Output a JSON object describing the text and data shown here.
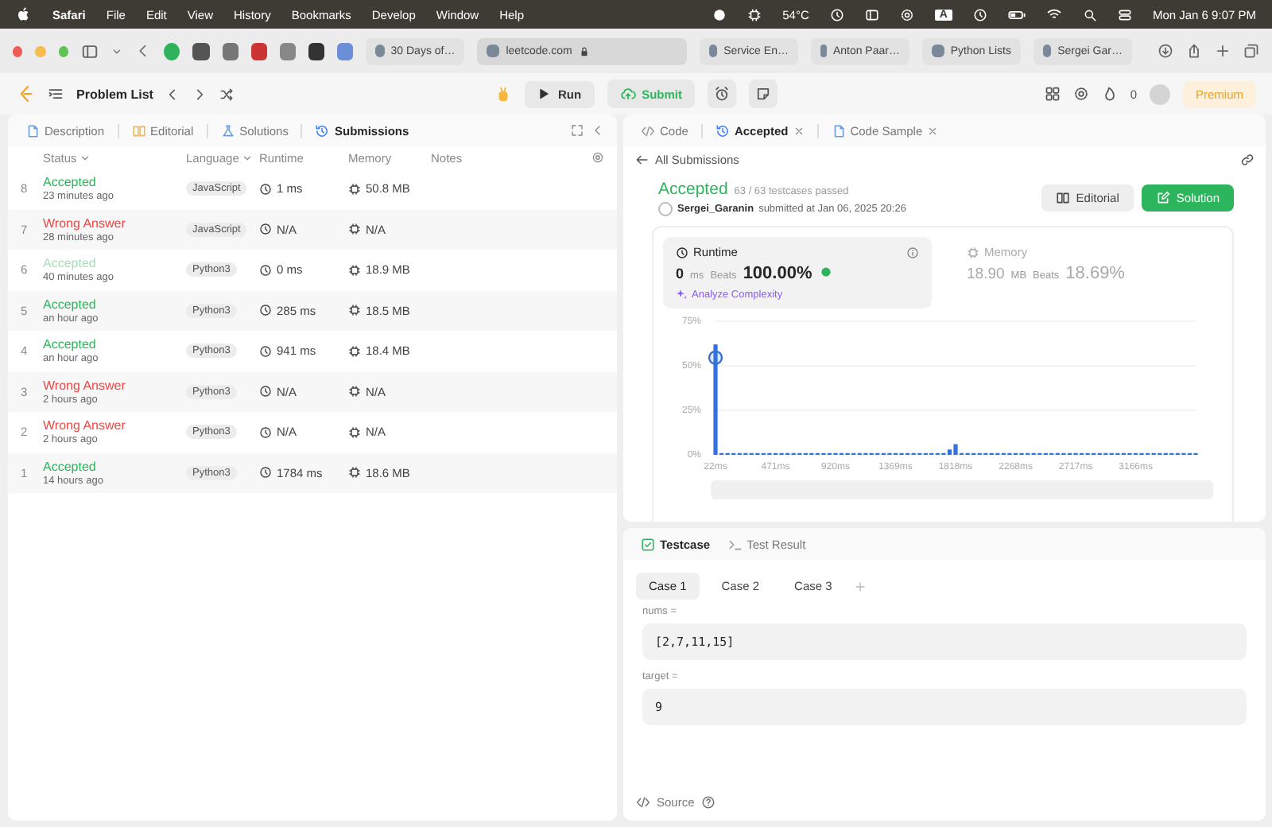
{
  "menu_bar": {
    "app": "Safari",
    "items": [
      "File",
      "Edit",
      "View",
      "History",
      "Bookmarks",
      "Develop",
      "Window",
      "Help"
    ],
    "temperature": "54°C",
    "input_source": "A",
    "clock": "Mon Jan 6  9:07 PM"
  },
  "browser": {
    "tabs": [
      {
        "label": "30 Days of…",
        "selected": false
      },
      {
        "label": "leetcode.com",
        "selected": true
      },
      {
        "label": "Service En…",
        "selected": false
      },
      {
        "label": "Anton Paar…",
        "selected": false
      },
      {
        "label": "Python Lists",
        "selected": false
      },
      {
        "label": "Sergei Gar…",
        "selected": false
      }
    ]
  },
  "nav": {
    "title": "Problem List",
    "run": "Run",
    "submit": "Submit",
    "streak": "0",
    "premium": "Premium"
  },
  "left_panel": {
    "tabs": [
      {
        "label": "Description",
        "selected": false
      },
      {
        "label": "Editorial",
        "selected": false
      },
      {
        "label": "Solutions",
        "selected": false
      },
      {
        "label": "Submissions",
        "selected": true
      }
    ],
    "columns": [
      "Status",
      "Language",
      "Runtime",
      "Memory",
      "Notes"
    ],
    "rows": [
      {
        "index": "8",
        "status": "Accepted",
        "kind": "accepted",
        "time": "23 minutes ago",
        "language": "JavaScript",
        "runtime": "1 ms",
        "memory": "50.8 MB",
        "selected": false
      },
      {
        "index": "7",
        "status": "Wrong Answer",
        "kind": "wrong",
        "time": "28 minutes ago",
        "language": "JavaScript",
        "runtime": "N/A",
        "memory": "N/A",
        "selected": false
      },
      {
        "index": "6",
        "status": "Accepted",
        "kind": "accepted",
        "time": "40 minutes ago",
        "language": "Python3",
        "runtime": "0 ms",
        "memory": "18.9 MB",
        "selected": true
      },
      {
        "index": "5",
        "status": "Accepted",
        "kind": "accepted",
        "time": "an hour ago",
        "language": "Python3",
        "runtime": "285 ms",
        "memory": "18.5 MB",
        "selected": false
      },
      {
        "index": "4",
        "status": "Accepted",
        "kind": "accepted",
        "time": "an hour ago",
        "language": "Python3",
        "runtime": "941 ms",
        "memory": "18.4 MB",
        "selected": false
      },
      {
        "index": "3",
        "status": "Wrong Answer",
        "kind": "wrong",
        "time": "2 hours ago",
        "language": "Python3",
        "runtime": "N/A",
        "memory": "N/A",
        "selected": false
      },
      {
        "index": "2",
        "status": "Wrong Answer",
        "kind": "wrong",
        "time": "2 hours ago",
        "language": "Python3",
        "runtime": "N/A",
        "memory": "N/A",
        "selected": false
      },
      {
        "index": "1",
        "status": "Accepted",
        "kind": "accepted",
        "time": "14 hours ago",
        "language": "Python3",
        "runtime": "1784 ms",
        "memory": "18.6 MB",
        "selected": false
      }
    ]
  },
  "right_panel": {
    "tabs": [
      {
        "label": "Code",
        "selected": false,
        "closable": false
      },
      {
        "label": "Accepted",
        "selected": true,
        "closable": true
      },
      {
        "label": "Code Sample",
        "selected": false,
        "closable": true
      }
    ],
    "back_link": "All Submissions",
    "result": {
      "status": "Accepted",
      "passed": "63 / 63 testcases passed",
      "user": "Sergei_Garanin",
      "submitted": "submitted at Jan 06, 2025 20:26"
    },
    "buttons": [
      "Editorial",
      "Solution"
    ],
    "metrics": [
      {
        "label": "Runtime",
        "value": "0",
        "unit": "ms",
        "beats_label": "Beats",
        "beats": "100.00%",
        "action": "Analyze Complexity",
        "selected": true
      },
      {
        "label": "Memory",
        "value": "18.90",
        "unit": "MB",
        "beats_label": "Beats",
        "beats": "18.69%",
        "selected": false
      }
    ],
    "chart_data": {
      "type": "bar",
      "x": [
        22,
        67,
        112,
        157,
        202,
        247,
        291,
        336,
        381,
        426,
        471,
        516,
        561,
        606,
        651,
        696,
        740,
        785,
        830,
        875,
        920,
        965,
        1010,
        1055,
        1100,
        1145,
        1189,
        1234,
        1279,
        1324,
        1369,
        1414,
        1459,
        1504,
        1549,
        1594,
        1638,
        1683,
        1728,
        1773,
        1818,
        1863,
        1908,
        1953,
        1998,
        2043,
        2087,
        2132,
        2177,
        2222,
        2267,
        2312,
        2357,
        2402,
        2447,
        2492,
        2536,
        2581,
        2626,
        2671,
        2716,
        2761,
        2806,
        2851,
        2896,
        2941,
        2985,
        3030,
        3075,
        3120,
        3165,
        3210,
        3255,
        3300,
        3345,
        3390,
        3434,
        3479,
        3524,
        3569,
        3614
      ],
      "values": [
        62,
        1,
        1,
        1,
        1,
        1,
        1,
        1,
        1,
        1,
        1,
        1,
        1,
        1,
        1,
        1,
        1,
        1,
        1,
        1,
        1,
        1,
        1,
        1,
        1,
        1,
        1,
        1,
        1,
        1,
        1,
        1,
        1,
        1,
        1,
        1,
        1,
        1,
        1,
        3,
        6,
        1,
        1,
        1,
        1,
        1,
        1,
        1,
        1,
        1,
        1,
        1,
        1,
        1,
        1,
        1,
        1,
        1,
        1,
        1,
        1,
        1,
        1,
        1,
        1,
        1,
        1,
        1,
        1,
        1,
        1,
        1,
        1,
        1,
        1,
        1,
        1,
        1,
        1,
        1,
        1
      ],
      "xlim": [
        22,
        3614
      ],
      "ylim": [
        0,
        75
      ],
      "xticks": [
        {
          "value": 22,
          "label": "22ms"
        },
        {
          "value": 471,
          "label": "471ms"
        },
        {
          "value": 920,
          "label": "920ms"
        },
        {
          "value": 1369,
          "label": "1369ms"
        },
        {
          "value": 1818,
          "label": "1818ms"
        },
        {
          "value": 2268,
          "label": "2268ms"
        },
        {
          "value": 2717,
          "label": "2717ms"
        },
        {
          "value": 3166,
          "label": "3166ms"
        }
      ],
      "yticks": [
        {
          "value": 0,
          "label": "0%"
        },
        {
          "value": 25,
          "label": "25%"
        },
        {
          "value": 50,
          "label": "50%"
        },
        {
          "value": 75,
          "label": "75%"
        }
      ]
    }
  },
  "testcase_panel": {
    "tabs": [
      {
        "label": "Testcase",
        "selected": true
      },
      {
        "label": "Test Result",
        "selected": false
      }
    ],
    "cases": [
      {
        "label": "Case 1",
        "selected": true
      },
      {
        "label": "Case 2",
        "selected": false
      },
      {
        "label": "Case 3",
        "selected": false
      }
    ],
    "inputs": [
      {
        "label": "nums =",
        "value": "[2,7,11,15]"
      },
      {
        "label": "target =",
        "value": "9"
      }
    ],
    "source": "Source"
  }
}
